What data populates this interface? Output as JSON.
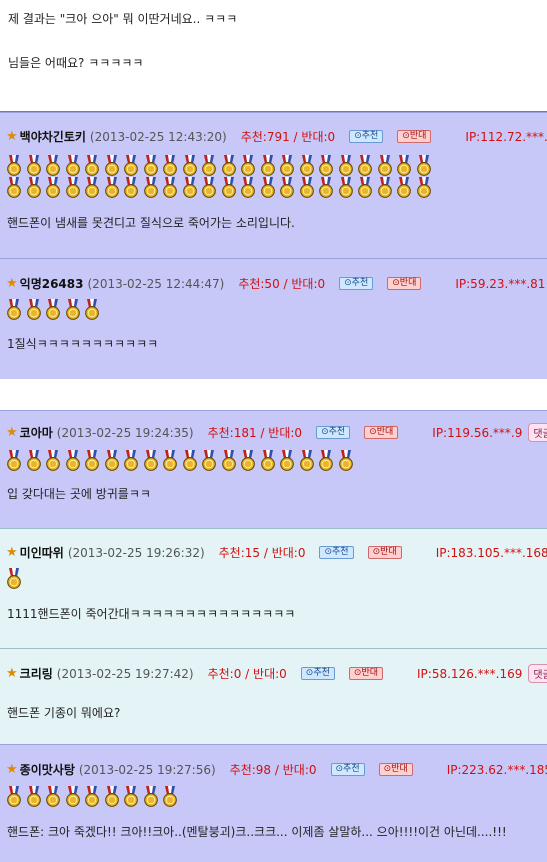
{
  "intro": {
    "line1": "제 결과는 \"크아 으아\" 뭐 이딴거네요.. ㅋㅋㅋ",
    "line2": "님들은 어때요? ㅋㅋㅋㅋㅋ"
  },
  "labels": {
    "recommend_button": "⊙추천",
    "oppose_button": "⊙반대",
    "reply_button": "댓글쓰"
  },
  "comments": [
    {
      "nick": "백야차긴토키",
      "date": "(2013-02-25 12:43:20)",
      "votes": "추천:791 / 반대:0",
      "ip": "IP:112.72.***.19",
      "text": "핸드폰이 냄새를 못견디고 질식으로 죽어가는 소리입니다.",
      "medals": 44,
      "style": "purple",
      "reply": false
    },
    {
      "nick": "익명26483",
      "date": "(2013-02-25 12:44:47)",
      "votes": "추천:50 / 반대:0",
      "ip": "IP:59.23.***.81",
      "text": "1질식ㅋㅋㅋㅋㅋㅋㅋㅋㅋㅋㅋ",
      "medals": 5,
      "style": "purple",
      "reply": true
    },
    {
      "nick": "코아마",
      "date": "(2013-02-25 19:24:35)",
      "votes": "추천:181 / 반대:0",
      "ip": "IP:119.56.***.9",
      "text": "입 갖다대는 곳에 방귀를ㅋㅋ",
      "medals": 18,
      "style": "purple",
      "reply": true
    },
    {
      "nick": "미인따위",
      "date": "(2013-02-25 19:26:32)",
      "votes": "추천:15 / 반대:0",
      "ip": "IP:183.105.***.168",
      "text": "1111핸드폰이 죽어간대ㅋㅋㅋㅋㅋㅋㅋㅋㅋㅋㅋㅋㅋㅋㅋ",
      "medals": 1,
      "style": "cyan",
      "reply": true
    },
    {
      "nick": "크리링",
      "date": "(2013-02-25 19:27:42)",
      "votes": "추천:0 / 반대:0",
      "ip": "IP:58.126.***.169",
      "text": "핸드폰 기종이 뭐에요?",
      "medals": 0,
      "style": "cyan",
      "reply": true
    },
    {
      "nick": "종이맛사탕",
      "date": "(2013-02-25 19:27:56)",
      "votes": "추천:98 / 반대:0",
      "ip": "IP:223.62.***.185",
      "text": "핸드폰: 크아 죽겠다!! 크아!!크아..(멘탈붕괴)크..크크... 이제좀 살말하... 으아!!!!이건 아닌데....!!!",
      "medals": 9,
      "style": "purple",
      "reply": true
    }
  ],
  "colors": {
    "purple_bg": "#c8c8f8",
    "cyan_bg": "#e4f4f6",
    "votes_red": "#d01010",
    "medal_gold": "#e8b62a",
    "ribbon_red": "#c02020",
    "ribbon_blue": "#3050b0"
  }
}
